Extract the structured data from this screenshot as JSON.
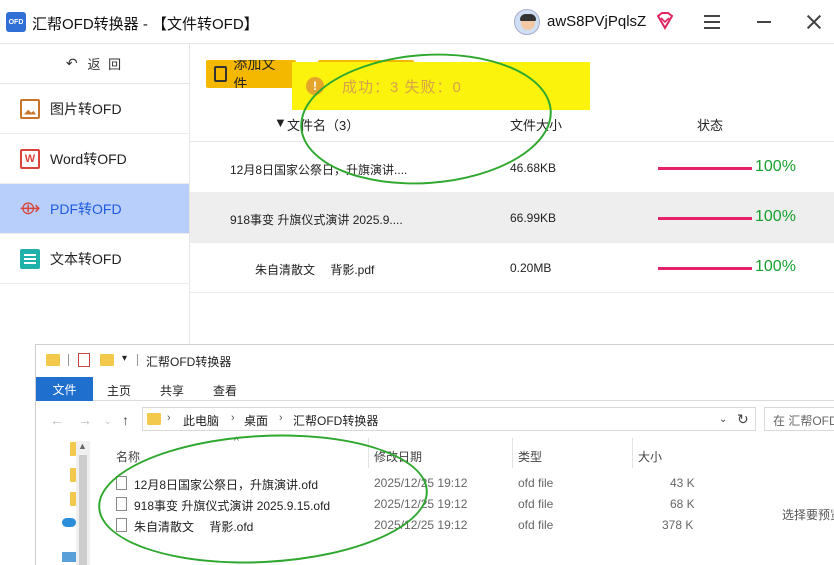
{
  "app": {
    "logo_text": "OFD",
    "title": "汇帮OFD转换器 - 【文件转OFD】",
    "username": "awS8PVjPqlsZ",
    "vip_icon": "vip-diamond-icon",
    "menu_icon": "hamburger-menu-icon",
    "minimize_icon": "minimize-icon",
    "close_icon": "close-icon"
  },
  "sidebar": {
    "back_label": "返 回",
    "back_icon": "back-arrow-icon",
    "items": [
      {
        "label": "图片转OFD",
        "icon": "image-icon",
        "active": false
      },
      {
        "label": "Word转OFD",
        "icon": "word-icon",
        "active": false
      },
      {
        "label": "PDF转OFD",
        "icon": "pdf-icon",
        "active": true
      },
      {
        "label": "文本转OFD",
        "icon": "text-file-icon",
        "active": false
      }
    ]
  },
  "toolbar": {
    "add_file_label": "添加文件"
  },
  "toast": {
    "message": "成功：3   失败：0",
    "icon": "warning-icon"
  },
  "table": {
    "columns": {
      "name": "文件名（3）",
      "size": "文件大小",
      "status": "状态"
    },
    "rows": [
      {
        "name": "12月8日国家公祭日，升旗演讲....",
        "size": "46.68KB",
        "progress": 1.0,
        "pct": "100%"
      },
      {
        "name": "918事变 升旗仪式演讲 2025.9....",
        "size": "66.99KB",
        "progress": 1.0,
        "pct": "100%"
      },
      {
        "name": "朱自清散文　 背影.pdf",
        "size": "0.20MB",
        "progress": 1.0,
        "pct": "100%"
      }
    ],
    "progress_color": "#e6226a",
    "pct_color": "#16a02c"
  },
  "explorer": {
    "title": "汇帮OFD转换器",
    "ribbon_tabs": [
      "文件",
      "主页",
      "共享",
      "查看"
    ],
    "breadcrumb": [
      "此电脑",
      "桌面",
      "汇帮OFD转换器"
    ],
    "search_placeholder": "在 汇帮OFD转换器",
    "columns": {
      "name": "名称",
      "modified": "修改日期",
      "type": "类型",
      "size": "大小"
    },
    "files": [
      {
        "name": "12月8日国家公祭日，升旗演讲.ofd",
        "modified": "2025/12/25 19:12",
        "type": "ofd file",
        "size": "43 K"
      },
      {
        "name": "918事变 升旗仪式演讲 2025.9.15.ofd",
        "modified": "2025/12/25 19:12",
        "type": "ofd file",
        "size": "68 K"
      },
      {
        "name": "朱自清散文　 背影.ofd",
        "modified": "2025/12/25 19:12",
        "type": "ofd file",
        "size": "378 K"
      }
    ],
    "preview_text": "选择要预览"
  },
  "colors": {
    "accent_blue": "#1f6fcf",
    "active_nav_bg": "#b9cffb",
    "button_yellow": "#f5b800",
    "toast_bg": "#fbf30c",
    "annotation_green": "#2fa82f"
  }
}
